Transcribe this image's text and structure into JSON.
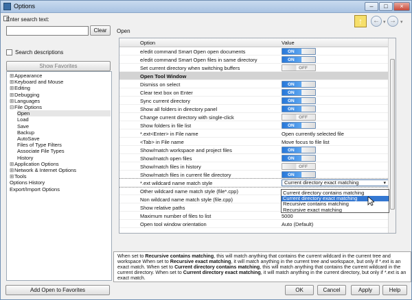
{
  "window": {
    "title": "Options",
    "min_label": "–",
    "max_label": "□",
    "close_label": "×"
  },
  "left": {
    "search_label": "Enter search text:",
    "search_value": "",
    "clear_label": "Clear",
    "search_descriptions": "Search descriptions",
    "show_favorites": "Show Favorites",
    "add_favorites": "Add Open to Favorites",
    "tree": [
      {
        "label": "Appearance",
        "level": 0,
        "toggle": "⊞"
      },
      {
        "label": "Keyboard and Mouse",
        "level": 0,
        "toggle": "⊞"
      },
      {
        "label": "Editing",
        "level": 0,
        "toggle": "⊞"
      },
      {
        "label": "Debugging",
        "level": 0,
        "toggle": "⊞"
      },
      {
        "label": "Languages",
        "level": 0,
        "toggle": "⊞"
      },
      {
        "label": "File Options",
        "level": 0,
        "toggle": "⊟"
      },
      {
        "label": "Open",
        "level": 1,
        "selected": true
      },
      {
        "label": "Load",
        "level": 1
      },
      {
        "label": "Save",
        "level": 1
      },
      {
        "label": "Backup",
        "level": 1
      },
      {
        "label": "AutoSave",
        "level": 1
      },
      {
        "label": "Files of Type Filters",
        "level": 1
      },
      {
        "label": "Associate File Types",
        "level": 1
      },
      {
        "label": "History",
        "level": 1
      },
      {
        "label": "Application Options",
        "level": 0,
        "toggle": "⊞"
      },
      {
        "label": "Network & Internet Options",
        "level": 0,
        "toggle": "⊞"
      },
      {
        "label": "Tools",
        "level": 0,
        "toggle": "⊞"
      },
      {
        "label": "Options History",
        "level": 0
      },
      {
        "label": "Export/Import Options",
        "level": 0
      }
    ]
  },
  "main": {
    "page_heading": "Open",
    "nav_up": "↑",
    "nav_back": "←",
    "nav_fwd": "→",
    "nav_drop": "▾",
    "columns": {
      "option": "Option",
      "value": "Value"
    },
    "rows": [
      {
        "label": "e/edit command Smart Open open documents",
        "type": "toggle",
        "value": "ON"
      },
      {
        "label": "e/edit command Smart Open files in same directory",
        "type": "toggle",
        "value": "ON"
      },
      {
        "label": "Set current directory when switching buffers",
        "type": "toggle",
        "value": "OFF"
      },
      {
        "label": "Open Tool Window",
        "type": "section"
      },
      {
        "label": "Dismiss on select",
        "type": "toggle",
        "value": "ON"
      },
      {
        "label": "Clear text box on Enter",
        "type": "toggle",
        "value": "ON"
      },
      {
        "label": "Sync current directory",
        "type": "toggle",
        "value": "ON"
      },
      {
        "label": "Show all folders in directory panel",
        "type": "toggle",
        "value": "ON"
      },
      {
        "label": "Change current directory with single-click",
        "type": "toggle",
        "value": "OFF"
      },
      {
        "label": "Show folders in file list",
        "type": "toggle",
        "value": "ON"
      },
      {
        "label": "*.ext<Enter> in File name",
        "type": "text",
        "value": "Open currently selected file"
      },
      {
        "label": "<Tab> in File name",
        "type": "text",
        "value": "Move focus to file list"
      },
      {
        "label": "Show/match workspace and project files",
        "type": "toggle",
        "value": "ON"
      },
      {
        "label": "Show/match open files",
        "type": "toggle",
        "value": "ON"
      },
      {
        "label": "Show/match files in history",
        "type": "toggle",
        "value": "OFF"
      },
      {
        "label": "Show/match files in current file directory",
        "type": "toggle",
        "value": "ON"
      },
      {
        "label": "*.ext wildcard name match style",
        "type": "select",
        "value": "Current directory exact matching"
      },
      {
        "label": "Other wildcard name match style (file*.cpp)",
        "type": "text",
        "value": ""
      },
      {
        "label": "Non wildcard name match style (file.cpp)",
        "type": "text",
        "value": ""
      },
      {
        "label": "Show relative paths",
        "type": "text",
        "value": ""
      },
      {
        "label": "Maximum number of files to list",
        "type": "text",
        "value": "5000"
      },
      {
        "label": "Open tool window orientation",
        "type": "text",
        "value": "Auto (Default)"
      }
    ],
    "dropdown": [
      {
        "label": "Current directory contains matching"
      },
      {
        "label": "Current directory exact matching",
        "active": true
      },
      {
        "label": "Recursive contains matching"
      },
      {
        "label": "Recursive exact matching"
      }
    ],
    "description": [
      {
        "text": "When set to "
      },
      {
        "text": "Recursive contains matching",
        "bold": true
      },
      {
        "text": ", this will match anything that contains the current wildcard in the current tree and workspace When set to "
      },
      {
        "text": "Recursive exact matching",
        "bold": true
      },
      {
        "text": ", it will match anything in the current tree and workspace, but only if *.ext is an exact match. When set to "
      },
      {
        "text": "Current directory contains matching",
        "bold": true
      },
      {
        "text": ", this will match anything that contains the current wildcard in the current directory. When set to "
      },
      {
        "text": "Current directory exact matching",
        "bold": true
      },
      {
        "text": ", it will match anything in the current directory, but only if *.ext is an exact match."
      }
    ],
    "buttons": {
      "ok": "OK",
      "cancel": "Cancel",
      "apply": "Apply",
      "help": "Help"
    }
  }
}
